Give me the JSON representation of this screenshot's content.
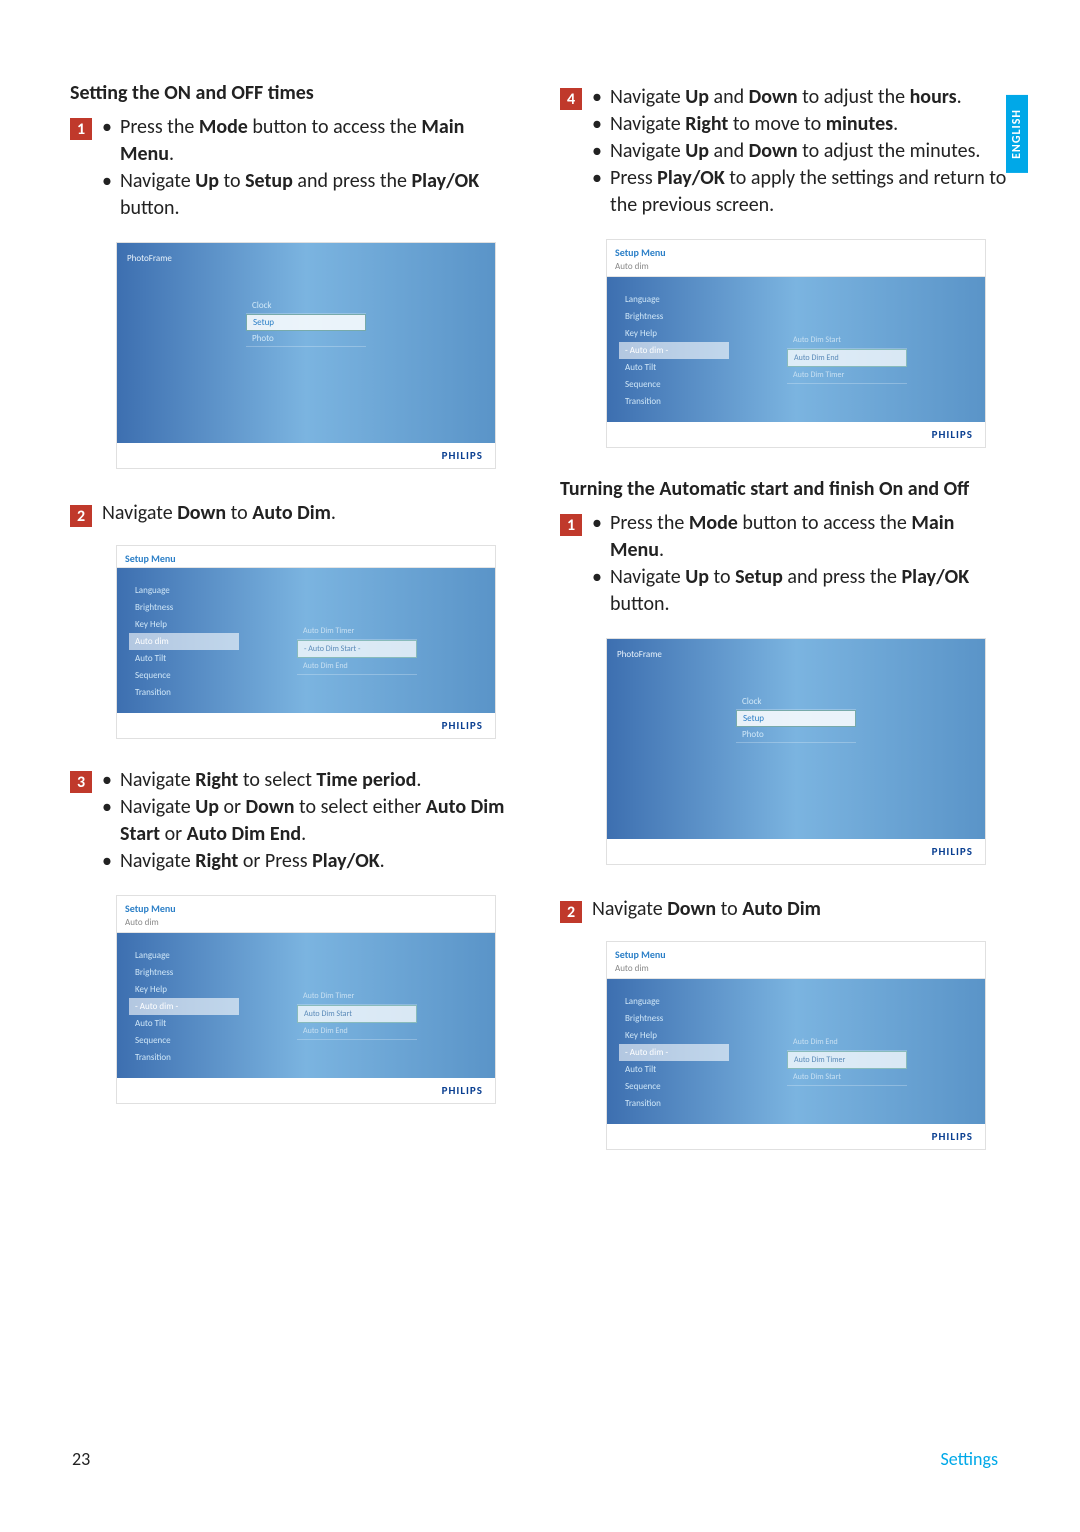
{
  "sideTab": "ENGLISH",
  "pageNumber": "23",
  "pageSection": "Settings",
  "philips": "PHILIPS",
  "left": {
    "title1": "Setting the ON and OFF times",
    "s1b1": "Press the Mode button to access the Main Menu.",
    "s1b2": "Navigate Up to Setup and press the Play/OK button.",
    "s2": "Navigate Down to Auto Dim.",
    "s3b1": "Navigate Right to select Time period.",
    "s3b2": "Navigate Up or Down to select either Auto Dim Start or Auto Dim End.",
    "s3b3": "Navigate Right or Press Play/OK."
  },
  "right": {
    "s4b1": "Navigate Up and Down to adjust the hours.",
    "s4b2": "Navigate Right to move to minutes.",
    "s4b3": "Navigate Up and Down to adjust the minutes.",
    "s4b4": "Press Play/OK to apply the settings and return to the previous screen.",
    "title2": "Turning the Automatic start and finish On and Off",
    "s1b1": "Press the Mode button to access the Main Menu.",
    "s1b2": "Navigate Up to Setup and press the Play/OK button.",
    "s2": "Navigate Down to Auto Dim"
  },
  "shot": {
    "photoframe": "PhotoFrame",
    "setupMenu": "Setup Menu",
    "autoDim": "Auto dim",
    "centerItems": [
      "Clock",
      "Setup",
      "Photo"
    ],
    "leftItems": [
      "Language",
      "Brightness",
      "Key Help",
      "Auto dim",
      "Auto Tilt",
      "Sequence",
      "Transition"
    ],
    "leftItemsSel": [
      "Language",
      "Brightness",
      "Key Help",
      "- Auto dim -",
      "Auto Tilt",
      "Sequence",
      "Transition"
    ],
    "popup_b": [
      "Auto Dim Timer",
      "- Auto Dim Start -",
      "Auto Dim End"
    ],
    "popup_c": [
      "Auto Dim Timer",
      "Auto Dim Start",
      "Auto Dim End"
    ],
    "popup_d": [
      "Auto Dim Start",
      "Auto Dim End",
      "Auto Dim Timer"
    ],
    "popup_f": [
      "Auto Dim End",
      "Auto Dim Timer",
      "Auto Dim Start"
    ]
  }
}
